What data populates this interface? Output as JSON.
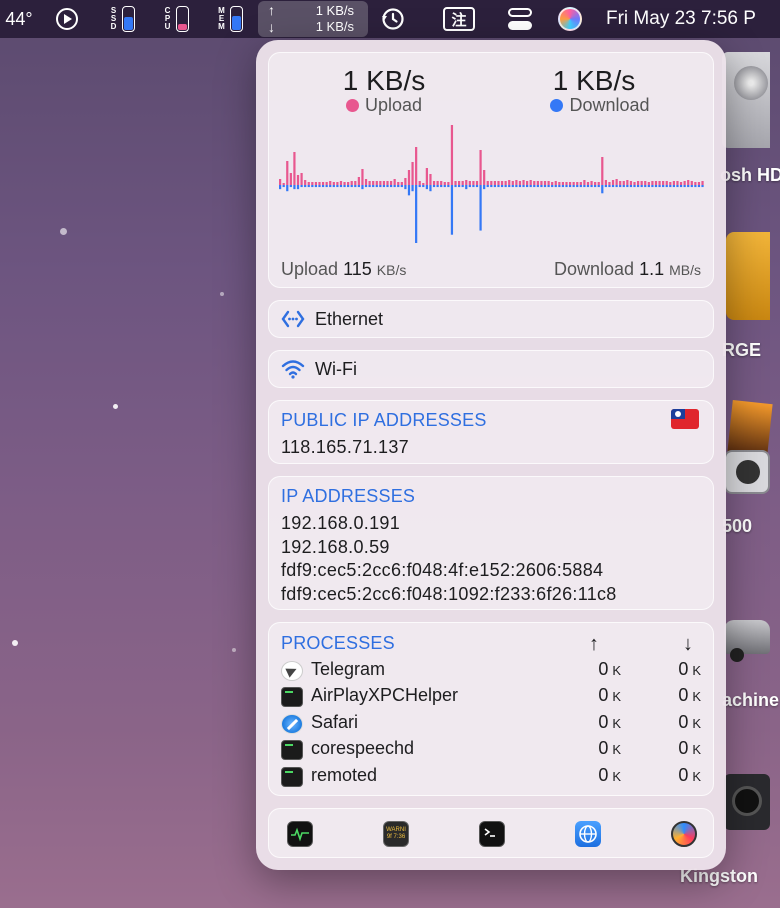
{
  "menubar": {
    "temperature": "44°",
    "ssd_letters": "S\nS\nD",
    "cpu_letters": "C\nP\nU",
    "mem_letters": "M\nE\nM",
    "ssd_level": 0.55,
    "cpu_level": 0.25,
    "mem_level": 0.6,
    "net_arrows": "↑\n↓",
    "net_upload": "1 KB/s",
    "net_download": "1 KB/s",
    "input_method": "注",
    "clock": "Fri May 23  7:56 P"
  },
  "desktop": {
    "labels": [
      "osh HD",
      "RGE",
      "500",
      "achine",
      "Kingston"
    ]
  },
  "network": {
    "upload_rate": "1 KB/s",
    "upload_label": "Upload",
    "download_rate": "1 KB/s",
    "download_label": "Download",
    "upload_color": "#e8578f",
    "download_color": "#3478f6",
    "peak_upload_label": "Upload",
    "peak_upload_value": "115",
    "peak_upload_unit": "KB/s",
    "peak_download_label": "Download",
    "peak_download_value": "1.1",
    "peak_download_unit": "MB/s"
  },
  "chart_data": {
    "type": "bar",
    "series": [
      {
        "values": [
          6,
          2,
          24,
          12,
          33,
          10,
          12,
          5,
          3,
          3,
          3,
          3,
          3,
          3,
          4,
          3,
          3,
          4,
          3,
          3,
          4,
          4,
          8,
          16,
          6,
          4,
          4,
          4,
          4,
          4,
          4,
          4,
          6,
          3,
          3,
          7,
          15,
          23,
          38,
          4,
          2,
          17,
          11,
          4,
          4,
          4,
          3,
          3,
          60,
          4,
          4,
          4,
          5,
          4,
          4,
          4,
          35,
          15,
          4,
          4,
          4,
          4,
          4,
          4,
          5,
          4,
          5,
          4,
          5,
          4,
          5,
          4,
          4,
          4,
          4,
          4,
          3,
          4,
          3,
          3,
          3,
          3,
          3,
          3,
          3,
          5,
          3,
          4,
          3,
          3,
          28,
          5,
          3,
          5,
          6,
          4,
          4,
          5,
          4,
          3,
          4,
          4,
          4,
          3,
          4,
          4,
          4,
          4,
          4,
          3,
          4,
          4,
          3,
          4,
          5,
          4,
          3,
          3,
          4
        ]
      },
      {
        "values": [
          2,
          1,
          3,
          1,
          2,
          2,
          1,
          1,
          1,
          1,
          1,
          1,
          1,
          1,
          1,
          1,
          1,
          1,
          1,
          1,
          1,
          1,
          1,
          2,
          1,
          1,
          1,
          1,
          1,
          1,
          1,
          1,
          1,
          1,
          1,
          2,
          5,
          3,
          28,
          1,
          1,
          2,
          3,
          1,
          1,
          1,
          1,
          1,
          24,
          1,
          1,
          1,
          2,
          1,
          1,
          1,
          22,
          2,
          1,
          1,
          1,
          1,
          1,
          1,
          1,
          1,
          1,
          1,
          1,
          1,
          1,
          1,
          1,
          1,
          1,
          1,
          1,
          1,
          1,
          1,
          1,
          1,
          1,
          1,
          1,
          1,
          1,
          1,
          1,
          1,
          4,
          1,
          1,
          1,
          1,
          1,
          1,
          1,
          1,
          1,
          1,
          1,
          1,
          1,
          1,
          1,
          1,
          1,
          1,
          1,
          1,
          1,
          1,
          1,
          1,
          1,
          1,
          1,
          1
        ]
      }
    ],
    "colors": [
      "#e8578f",
      "#3478f6"
    ],
    "xlabel": "",
    "ylabel": ""
  },
  "interfaces": {
    "ethernet_label": "Ethernet",
    "wifi_label": "Wi-Fi"
  },
  "public_ip": {
    "title": "PUBLIC IP ADDRESSES",
    "address": "118.165.71.137",
    "flag_icon": "taiwan-flag-icon"
  },
  "ip_addresses": {
    "title": "IP ADDRESSES",
    "list": [
      "192.168.0.191",
      "192.168.0.59",
      "fdf9:cec5:2cc6:f048:4f:e152:2606:5884",
      "fdf9:cec5:2cc6:f048:1092:f233:6f26:11c8"
    ]
  },
  "processes": {
    "title": "PROCESSES",
    "up_header": "↑",
    "down_header": "↓",
    "rows": [
      {
        "name": "Telegram",
        "icon": "telegram-icon",
        "up": "0",
        "down": "0",
        "unit": "K"
      },
      {
        "name": "AirPlayXPCHelper",
        "icon": "terminal-icon",
        "up": "0",
        "down": "0",
        "unit": "K"
      },
      {
        "name": "Safari",
        "icon": "safari-icon",
        "up": "0",
        "down": "0",
        "unit": "K"
      },
      {
        "name": "corespeechd",
        "icon": "terminal-icon",
        "up": "0",
        "down": "0",
        "unit": "K"
      },
      {
        "name": "remoted",
        "icon": "terminal-icon",
        "up": "0",
        "down": "0",
        "unit": "K"
      }
    ]
  },
  "toolbar": {
    "buttons": [
      "activity-monitor-icon",
      "console-icon",
      "terminal-icon",
      "network-globe-icon",
      "network-utility-icon"
    ],
    "console_badge": "WARNI\n9f 7:36"
  }
}
